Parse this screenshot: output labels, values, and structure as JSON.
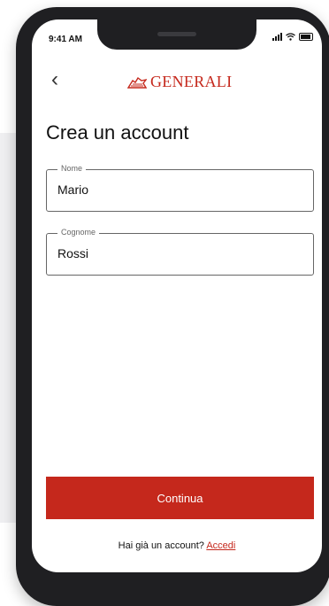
{
  "status_bar": {
    "time": "9:41 AM"
  },
  "header": {
    "brand": "GENERALI"
  },
  "page": {
    "title": "Crea un account"
  },
  "form": {
    "first_name": {
      "label": "Nome",
      "value": "Mario"
    },
    "last_name": {
      "label": "Cognome",
      "value": "Rossi"
    }
  },
  "actions": {
    "continue_label": "Continua"
  },
  "footer": {
    "prompt": "Hai già un account?",
    "login_link": "Accedi"
  },
  "colors": {
    "brand_red": "#c5281c"
  }
}
